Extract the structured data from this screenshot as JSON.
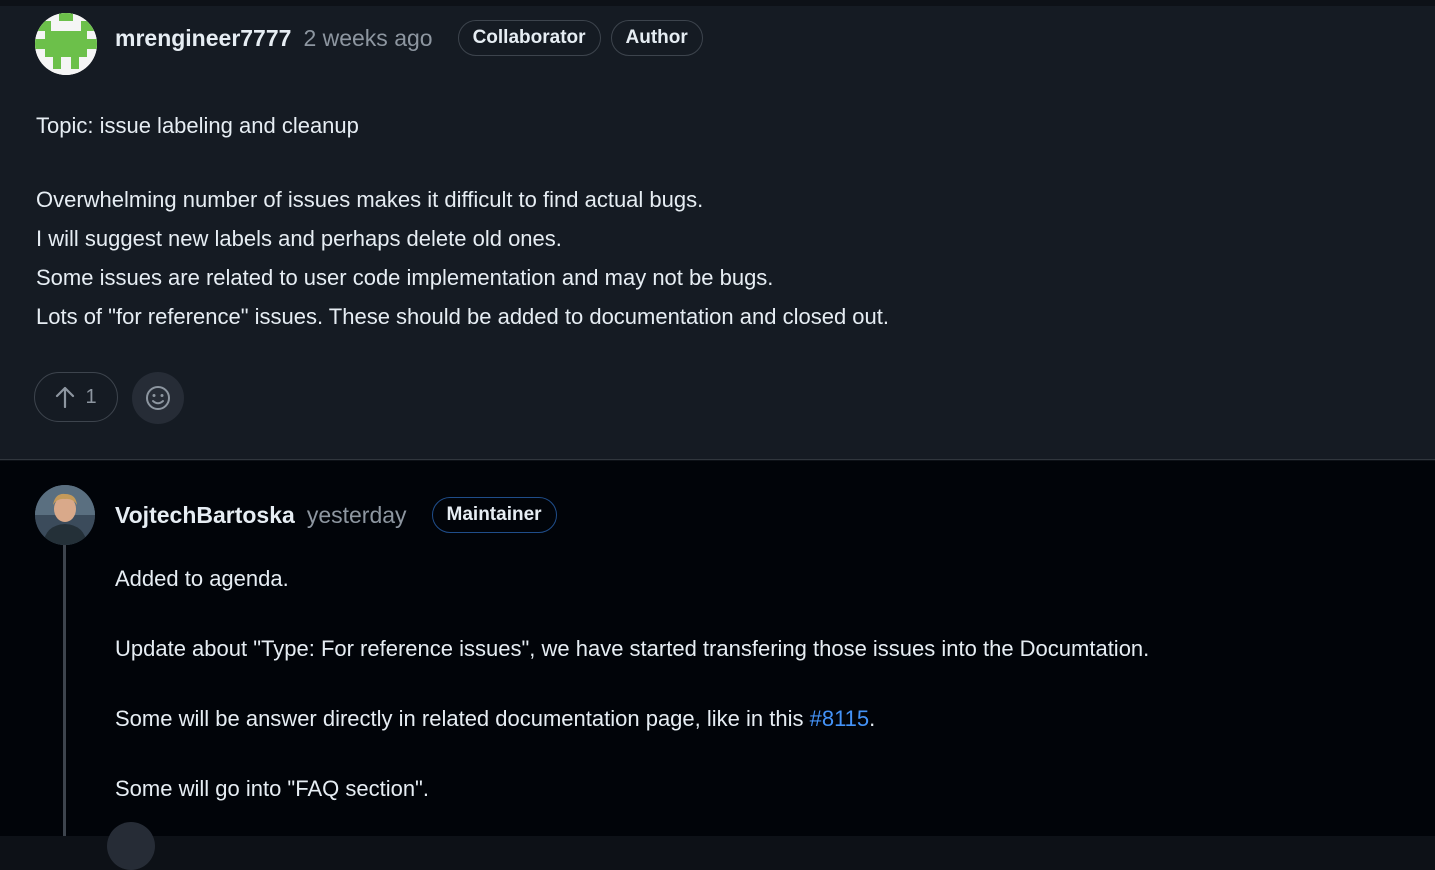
{
  "comments": [
    {
      "author": "mrengineer7777",
      "time": "2 weeks ago",
      "badges": [
        "Collaborator",
        "Author"
      ],
      "lines": [
        "Topic: issue labeling and cleanup",
        "Overwhelming number of issues makes it difficult to find actual bugs.",
        "I will suggest new labels and perhaps delete old ones.",
        "Some issues are related to user code implementation and may not be bugs.",
        "Lots of \"for reference\" issues. These should be added to documentation and closed out."
      ],
      "reactions": {
        "upvote_count": "1"
      }
    },
    {
      "author": "VojtechBartoska",
      "time": "yesterday",
      "badges": [
        "Maintainer"
      ],
      "paragraphs": [
        "Added to agenda.",
        "Update about \"Type: For reference issues\", we have started transfering those issues into the Documtation.",
        "Some will be answer directly in related documentation page, like in this ",
        "Some will go into \"FAQ section\"."
      ],
      "link_text": "#8115",
      "after_link": "."
    }
  ],
  "colors": {
    "background": "#0d1117",
    "comment_bg": "#151b23",
    "link": "#4493f8",
    "muted": "#8d96a0"
  }
}
